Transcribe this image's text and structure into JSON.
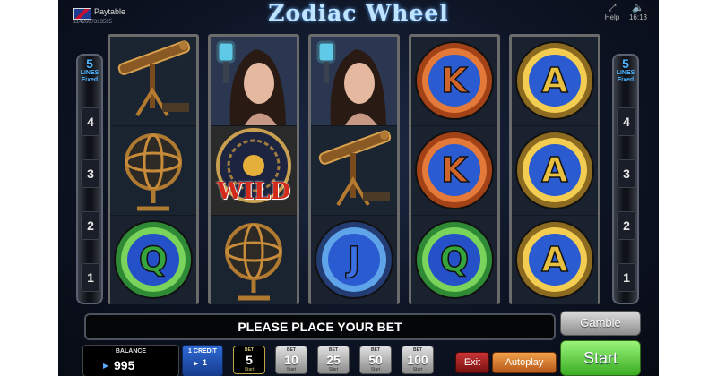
{
  "header": {
    "brand": "Paytable",
    "code": "1142607313595",
    "title": "Zodiac Wheel",
    "help_label": "Help",
    "clock": "16:13"
  },
  "lines_panel": {
    "count": "5",
    "lines_label": "LINES",
    "fixed_label": "Fixed",
    "numbers": [
      "4",
      "3",
      "2",
      "1"
    ]
  },
  "reels": [
    [
      "telescope",
      "armillary-sphere",
      "q"
    ],
    [
      "lady",
      "wild",
      "armillary-sphere"
    ],
    [
      "lady",
      "telescope",
      "j"
    ],
    [
      "k",
      "k",
      "q"
    ],
    [
      "a",
      "a",
      "a"
    ]
  ],
  "wild_label": "WILD",
  "message": "PLEASE PLACE YOUR BET",
  "buttons": {
    "gamble": "Gamble",
    "start": "Start",
    "exit": "Exit",
    "autoplay": "Autoplay"
  },
  "balance": {
    "label": "BALANCE",
    "value": "995"
  },
  "credit": {
    "label": "1 CREDIT",
    "value": "1"
  },
  "bets": [
    {
      "label": "BET",
      "value": "5",
      "sub": "Start"
    },
    {
      "label": "BET",
      "value": "10",
      "sub": "Start"
    },
    {
      "label": "BET",
      "value": "25",
      "sub": "Start"
    },
    {
      "label": "BET",
      "value": "50",
      "sub": "Start"
    },
    {
      "label": "BET",
      "value": "100",
      "sub": "Start"
    }
  ],
  "active_bet_index": 0,
  "colors": {
    "accent_blue": "#2f6bd6",
    "start_green": "#3aad22",
    "autoplay_orange": "#e2873a",
    "exit_red": "#b02525"
  }
}
